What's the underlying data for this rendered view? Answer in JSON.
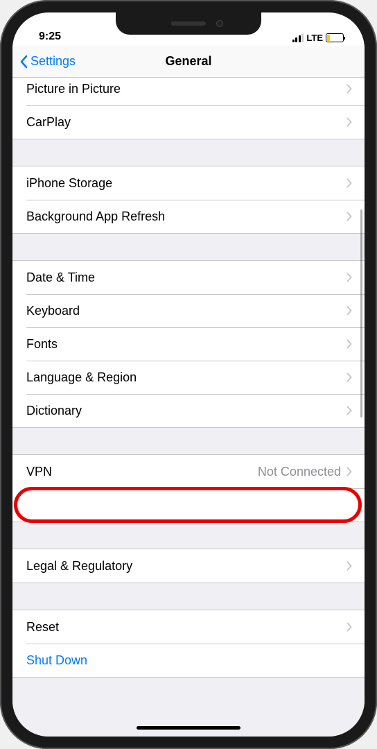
{
  "status": {
    "time": "9:25",
    "network_type": "LTE"
  },
  "nav": {
    "back_label": "Settings",
    "title": "General"
  },
  "groups": [
    {
      "rows": [
        {
          "label": "Picture in Picture",
          "value": "",
          "chevron": true,
          "action": false
        },
        {
          "label": "CarPlay",
          "value": "",
          "chevron": true,
          "action": false
        }
      ]
    },
    {
      "rows": [
        {
          "label": "iPhone Storage",
          "value": "",
          "chevron": true,
          "action": false
        },
        {
          "label": "Background App Refresh",
          "value": "",
          "chevron": true,
          "action": false
        }
      ]
    },
    {
      "rows": [
        {
          "label": "Date & Time",
          "value": "",
          "chevron": true,
          "action": false
        },
        {
          "label": "Keyboard",
          "value": "",
          "chevron": true,
          "action": false
        },
        {
          "label": "Fonts",
          "value": "",
          "chevron": true,
          "action": false
        },
        {
          "label": "Language & Region",
          "value": "",
          "chevron": true,
          "action": false
        },
        {
          "label": "Dictionary",
          "value": "",
          "chevron": true,
          "action": false
        }
      ]
    },
    {
      "rows": [
        {
          "label": "VPN",
          "value": "Not Connected",
          "chevron": true,
          "action": false
        },
        {
          "label": "",
          "value": "",
          "chevron": false,
          "action": false,
          "highlighted": true
        }
      ]
    },
    {
      "rows": [
        {
          "label": "Legal & Regulatory",
          "value": "",
          "chevron": true,
          "action": false
        }
      ]
    },
    {
      "rows": [
        {
          "label": "Reset",
          "value": "",
          "chevron": true,
          "action": false
        },
        {
          "label": "Shut Down",
          "value": "",
          "chevron": false,
          "action": true
        }
      ]
    }
  ]
}
